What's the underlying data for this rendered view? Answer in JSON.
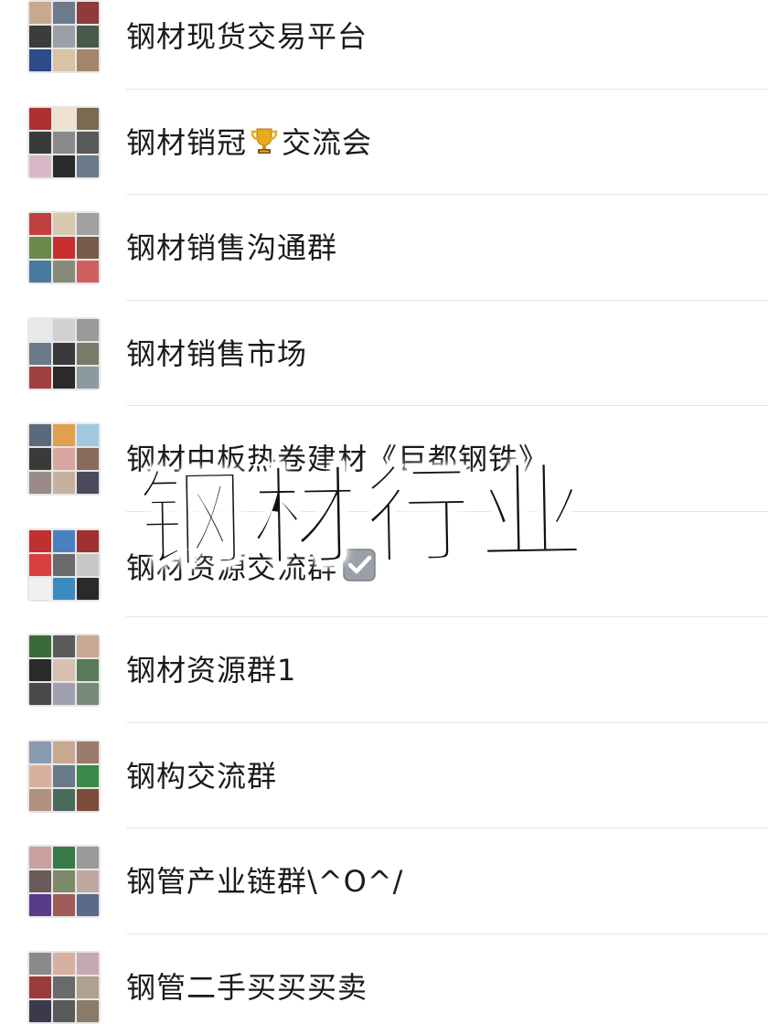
{
  "chats": [
    {
      "title": "钢材现货交易平台",
      "avatar_colors": [
        "#c9a98e",
        "#6b7b8c",
        "#8e3b3b",
        "#3c3c3c",
        "#9aa0a6",
        "#4a5a4a",
        "#2d4a8a",
        "#d9c3a5",
        "#a3856a"
      ]
    },
    {
      "title_part1": "钢材销冠",
      "emoji": "trophy",
      "title_part2": "交流会",
      "avatar_colors": [
        "#b03030",
        "#f0e0d0",
        "#7a6a50",
        "#3a3a3a",
        "#8a8a8a",
        "#5a5a5a",
        "#d8b8c8",
        "#2a2a2a",
        "#6a7a8a"
      ]
    },
    {
      "title": "钢材销售沟通群",
      "avatar_colors": [
        "#c04040",
        "#d8c8b0",
        "#a0a0a0",
        "#6a8a4a",
        "#c83030",
        "#7a5a4a",
        "#4a7aa0",
        "#8a8a7a",
        "#d06060"
      ]
    },
    {
      "title": "钢材销售市场",
      "avatar_colors": [
        "#e8e8e8",
        "#d0d0d0",
        "#9a9a9a",
        "#6a7a8a",
        "#3a3a3a",
        "#7a7a6a",
        "#a04040",
        "#2a2a2a",
        "#8a9aa0"
      ]
    },
    {
      "title": "钢材中板热卷建材《巨都钢铁》",
      "avatar_colors": [
        "#5a6a7a",
        "#e0a050",
        "#a0c8e0",
        "#3a3a3a",
        "#d8a8a0",
        "#8a6a5a",
        "#9a8a8a",
        "#c8b0a0",
        "#4a4a5a"
      ]
    },
    {
      "title_part1": "钢材资源交流群",
      "emoji": "check",
      "avatar_colors": [
        "#c03030",
        "#4a80c0",
        "#a03030",
        "#d84040",
        "#6a6a6a",
        "#c8c8c8",
        "#f0f0f0",
        "#3a8ac0",
        "#2a2a2a"
      ]
    },
    {
      "title": "钢材资源群1",
      "avatar_colors": [
        "#3a6a3a",
        "#5a5a5a",
        "#c8a890",
        "#2a2a2a",
        "#d8c0b0",
        "#5a7a5a",
        "#4a4a4a",
        "#a0a0b0",
        "#7a8a7a"
      ]
    },
    {
      "title": "钢构交流群",
      "avatar_colors": [
        "#8a9ab0",
        "#c8a890",
        "#9a7a6a",
        "#d8b0a0",
        "#6a7a8a",
        "#3a8a4a",
        "#b09080",
        "#4a6a5a",
        "#7a4a3a"
      ]
    },
    {
      "title": "钢管产业链群\\^O^/",
      "avatar_colors": [
        "#c8a0a0",
        "#3a7a4a",
        "#9a9a9a",
        "#6a5a5a",
        "#7a8a6a",
        "#c0a8a0",
        "#5a3a8a",
        "#a05a5a",
        "#5a6a8a"
      ]
    },
    {
      "title": "钢管二手买买买卖",
      "avatar_colors": [
        "#8a8a8a",
        "#d8b0a0",
        "#c8a8b0",
        "#9a3a3a",
        "#6a6a6a",
        "#b0a090",
        "#3a3a4a",
        "#5a5a5a",
        "#8a7a6a"
      ]
    }
  ],
  "overlay": {
    "title": "钢材行业"
  }
}
